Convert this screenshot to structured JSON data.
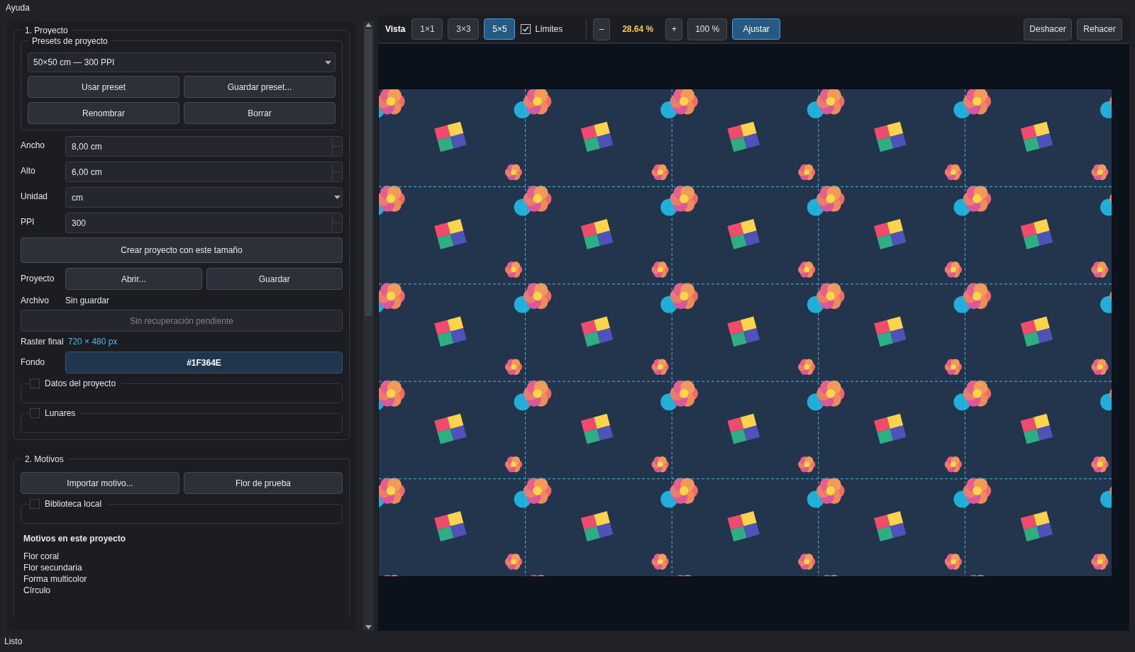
{
  "menu": [
    "Ayuda"
  ],
  "project": {
    "title": "1. Proyecto",
    "presets": {
      "title": "Presets de proyecto",
      "value": "50×50 cm — 300 PPI",
      "buttons": [
        "Usar preset",
        "Guardar preset...",
        "Renombrar",
        "Borrar"
      ]
    },
    "fields": [
      {
        "label": "Ancho",
        "value": "8,00 cm",
        "kind": "spin"
      },
      {
        "label": "Alto",
        "value": "6,00 cm",
        "kind": "spin"
      },
      {
        "label": "Unidad",
        "value": "cm",
        "kind": "combo"
      },
      {
        "label": "PPI",
        "value": "300",
        "kind": "spin"
      }
    ],
    "create_button": "Crear proyecto con este tamaño",
    "project_row": {
      "label": "Proyecto",
      "buttons": [
        "Abrir...",
        "Guardar"
      ]
    },
    "file": {
      "label": "Archivo",
      "value": "Sin guardar"
    },
    "recovery_button": {
      "label": "Sin recuperación pendiente",
      "disabled": true
    },
    "raster": {
      "label": "Raster final",
      "value": "720 × 480 px"
    },
    "background": {
      "label": "Fondo",
      "value": "#1F364E"
    },
    "groups": [
      {
        "title": "Datos del proyecto",
        "checked": false
      },
      {
        "title": "Lunares",
        "checked": false
      }
    ]
  },
  "motifs": {
    "title": "2. Motivos",
    "buttons": [
      "Importar motivo...",
      "Flor de prueba"
    ],
    "groups": [
      {
        "title": "Biblioteca local",
        "checked": false
      }
    ],
    "list_title": "Motivos en este proyecto",
    "items": [
      "Flor coral",
      "Flor secundaria",
      "Forma multicolor",
      "Círculo"
    ]
  },
  "toolbar": {
    "label": "Vista",
    "views": [
      {
        "label": "1×1",
        "selected": false
      },
      {
        "label": "3×3",
        "selected": false
      },
      {
        "label": "5×5",
        "selected": true
      }
    ],
    "bounds": {
      "label": "Límites",
      "checked": true
    },
    "zoom_out": "–",
    "zoom": "28.64 %",
    "zoom_in": "+",
    "actual": "100 %",
    "fit": {
      "label": "Ajustar",
      "selected": true
    },
    "undo": "Deshacer",
    "redo": "Rehacer"
  },
  "status": "Listo"
}
